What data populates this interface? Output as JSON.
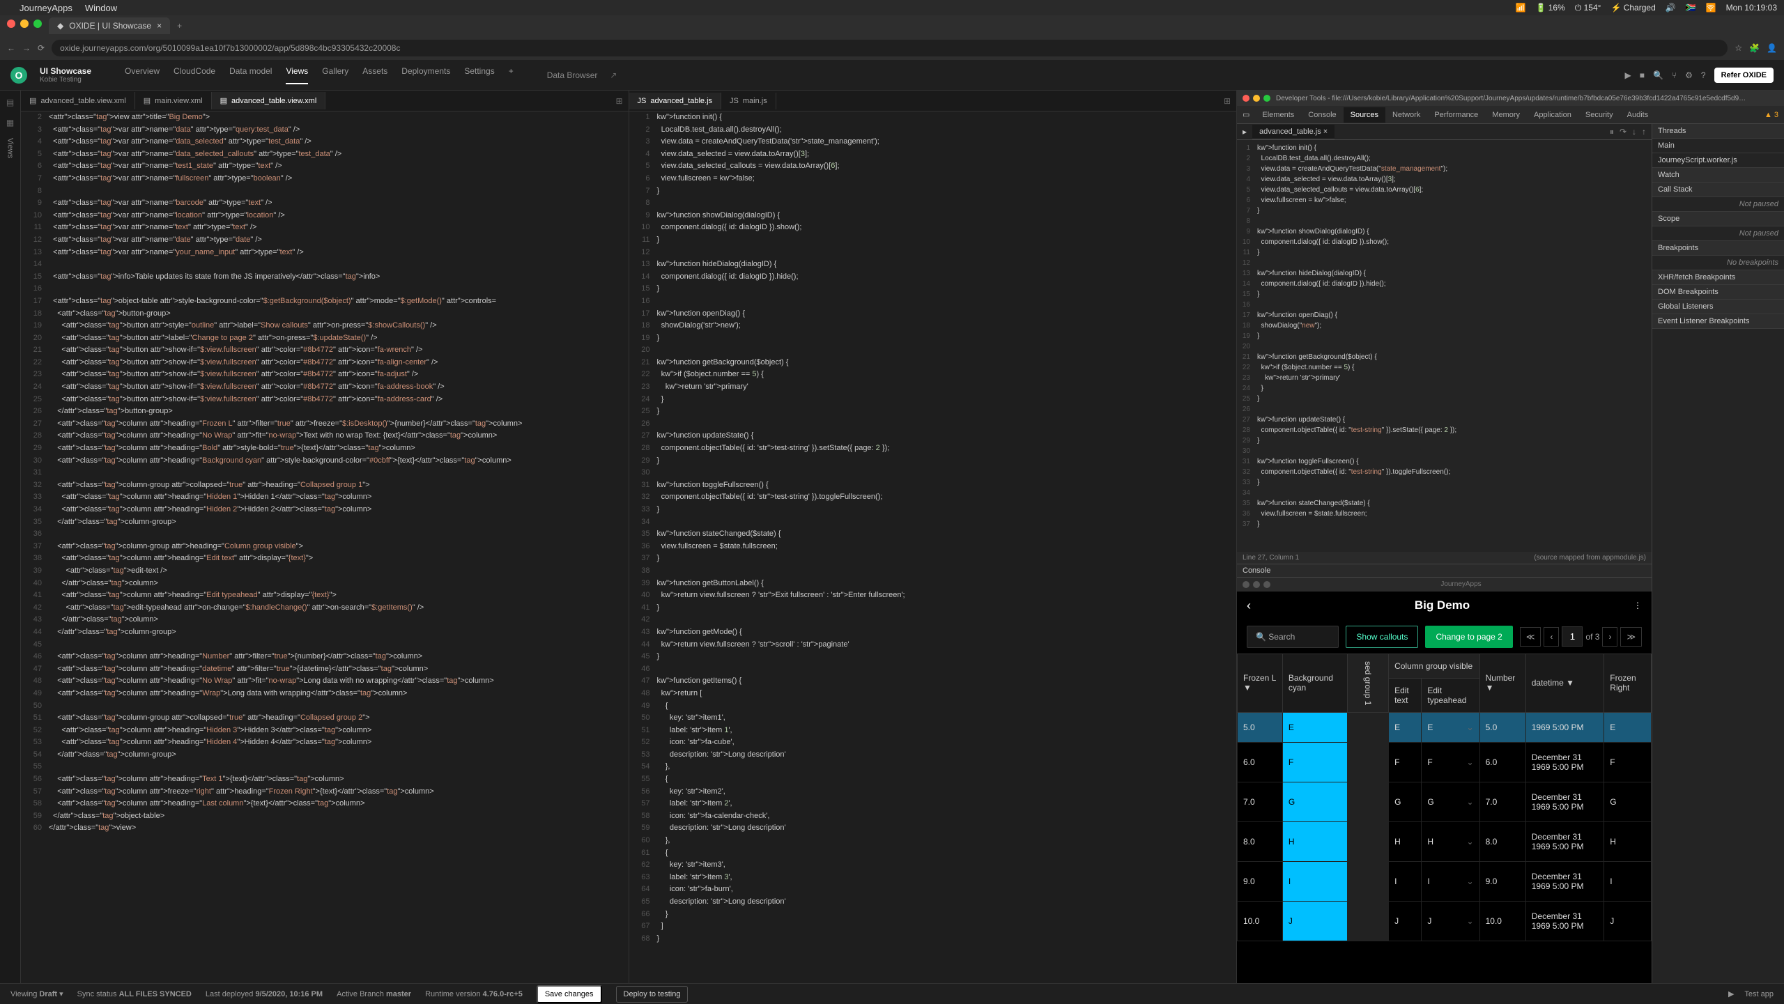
{
  "menubar": {
    "app": "JourneyApps",
    "menu1": "Window",
    "right": [
      "📶",
      "🔋 16%",
      "⏻ 154°",
      "⚡ Charged",
      "🔊",
      "🇿🇦",
      "🛜",
      "Mon 10:19:03"
    ]
  },
  "browser": {
    "tab_title": "OXIDE | UI Showcase",
    "url": "oxide.journeyapps.com/org/5010099a1ea10f7b13000002/app/5d898c4bc93305432c20008c"
  },
  "ide": {
    "title": "UI Showcase",
    "subtitle": "Kobie Testing",
    "tabs": [
      "Overview",
      "CloudCode",
      "Data model",
      "Views",
      "Gallery",
      "Assets",
      "Deployments",
      "Settings"
    ],
    "active_tab": "Views",
    "data_browser": "Data Browser",
    "refer": "Refer OXIDE"
  },
  "left_pane": {
    "tabs": [
      "advanced_table.view.xml",
      "main.view.xml",
      "advanced_table.view.xml"
    ],
    "active": 2,
    "code": [
      "<view title=\"Big Demo\">",
      "  <var name=\"data\" type=\"query:test_data\" />",
      "  <var name=\"data_selected\" type=\"test_data\" />",
      "  <var name=\"data_selected_callouts\" type=\"test_data\" />",
      "  <var name=\"test1_state\" type=\"text\" />",
      "  <var name=\"fullscreen\" type=\"boolean\" />",
      "",
      "  <var name=\"barcode\" type=\"text\" />",
      "  <var name=\"location\" type=\"location\" />",
      "  <var name=\"text\" type=\"text\" />",
      "  <var name=\"date\" type=\"date\" />",
      "  <var name=\"your_name_input\" type=\"text\" />",
      "",
      "  <info>Table updates its state from the JS imperatively</info>",
      "",
      "  <object-table style-background-color=\"$:getBackground($object)\" mode=\"$:getMode()\" controls=",
      "    <button-group>",
      "      <button style=\"outline\" label=\"Show callouts\" on-press=\"$:showCallouts()\" />",
      "      <button label=\"Change to page 2\" on-press=\"$:updateState()\" />",
      "      <button show-if=\"$:view.fullscreen\" color=\"#8b4772\" icon=\"fa-wrench\" />",
      "      <button show-if=\"$:view.fullscreen\" color=\"#8b4772\" icon=\"fa-align-center\" />",
      "      <button show-if=\"$:view.fullscreen\" color=\"#8b4772\" icon=\"fa-adjust\" />",
      "      <button show-if=\"$:view.fullscreen\" color=\"#8b4772\" icon=\"fa-address-book\" />",
      "      <button show-if=\"$:view.fullscreen\" color=\"#8b4772\" icon=\"fa-address-card\" />",
      "    </button-group>",
      "    <column heading=\"Frozen L\" filter=\"true\" freeze=\"$:isDesktop()\">{number}</column>",
      "    <column heading=\"No Wrap\" fit=\"no-wrap\">Text with no wrap Text: {text}</column>",
      "    <column heading=\"Bold\" style-bold=\"true\">{text}</column>",
      "    <column heading=\"Background cyan\" style-background-color=\"#0cbff\">{text}</column>",
      "",
      "    <column-group collapsed=\"true\" heading=\"Collapsed group 1\">",
      "      <column heading=\"Hidden 1\">Hidden 1</column>",
      "      <column heading=\"Hidden 2\">Hidden 2</column>",
      "    </column-group>",
      "",
      "    <column-group heading=\"Column group visible\">",
      "      <column heading=\"Edit text\" display=\"{text}\">",
      "        <edit-text />",
      "      </column>",
      "      <column heading=\"Edit typeahead\" display=\"{text}\">",
      "        <edit-typeahead on-change=\"$:handleChange()\" on-search=\"$:getItems()\" />",
      "      </column>",
      "    </column-group>",
      "",
      "    <column heading=\"Number\" filter=\"true\">{number}</column>",
      "    <column heading=\"datetime\" filter=\"true\">{datetime}</column>",
      "    <column heading=\"No Wrap\" fit=\"no-wrap\">Long data with no wrapping</column>",
      "    <column heading=\"Wrap\">Long data with wrapping</column>",
      "",
      "    <column-group collapsed=\"true\" heading=\"Collapsed group 2\">",
      "      <column heading=\"Hidden 3\">Hidden 3</column>",
      "      <column heading=\"Hidden 4\">Hidden 4</column>",
      "    </column-group>",
      "",
      "    <column heading=\"Text 1\">{text}</column>",
      "    <column freeze=\"right\" heading=\"Frozen Right\">{text}</column>",
      "    <column heading=\"Last column\">{text}</column>",
      "  </object-table>",
      "</view>"
    ]
  },
  "right_pane": {
    "tabs": [
      "advanced_table.js",
      "main.js"
    ],
    "active": 0,
    "code": [
      "function init() {",
      "  LocalDB.test_data.all().destroyAll();",
      "  view.data = createAndQueryTestData('state_management');",
      "  view.data_selected = view.data.toArray()[3];",
      "  view.data_selected_callouts = view.data.toArray()[6];",
      "  view.fullscreen = false;",
      "}",
      "",
      "function showDialog(dialogID) {",
      "  component.dialog({ id: dialogID }).show();",
      "}",
      "",
      "function hideDialog(dialogID) {",
      "  component.dialog({ id: dialogID }).hide();",
      "}",
      "",
      "function openDiag() {",
      "  showDialog('new');",
      "}",
      "",
      "function getBackground($object) {",
      "  if ($object.number == 5) {",
      "    return 'primary'",
      "  }",
      "}",
      "",
      "function updateState() {",
      "  component.objectTable({ id: 'test-string' }).setState({ page: 2 });",
      "}",
      "",
      "function toggleFullscreen() {",
      "  component.objectTable({ id: 'test-string' }).toggleFullscreen();",
      "}",
      "",
      "function stateChanged($state) {",
      "  view.fullscreen = $state.fullscreen;",
      "}",
      "",
      "function getButtonLabel() {",
      "  return view.fullscreen ? 'Exit fullscreen' : 'Enter fullscreen';",
      "}",
      "",
      "function getMode() {",
      "  return view.fullscreen ? 'scroll' : 'paginate'",
      "}",
      "",
      "function getItems() {",
      "  return [",
      "    {",
      "      key: 'item1',",
      "      label: 'Item 1',",
      "      icon: 'fa-cube',",
      "      description: 'Long description'",
      "    },",
      "    {",
      "      key: 'item2',",
      "      label: 'Item 2',",
      "      icon: 'fa-calendar-check',",
      "      description: 'Long description'",
      "    },",
      "    {",
      "      key: 'item3',",
      "      label: 'Item 3',",
      "      icon: 'fa-burn',",
      "      description: 'Long description'",
      "    }",
      "  ]",
      "}"
    ]
  },
  "devtools": {
    "title": "Developer Tools - file:///Users/kobie/Library/Application%20Support/JourneyApps/updates/runtime/b7bfbdca05e76e39b3fcd1422a4765c91e5edcdf5d9…",
    "tabs": [
      "Elements",
      "Console",
      "Sources",
      "Network",
      "Performance",
      "Memory",
      "Application",
      "Security",
      "Audits"
    ],
    "active": "Sources",
    "warnings": "▲ 3",
    "file": "advanced_table.js",
    "code": [
      "function init() {",
      "  LocalDB.test_data.all().destroyAll();",
      "  view.data = createAndQueryTestData(\"state_management\");",
      "  view.data_selected = view.data.toArray()[3];",
      "  view.data_selected_callouts = view.data.toArray()[6];",
      "  view.fullscreen = false;",
      "}",
      "",
      "function showDialog(dialogID) {",
      "  component.dialog({ id: dialogID }).show();",
      "}",
      "",
      "function hideDialog(dialogID) {",
      "  component.dialog({ id: dialogID }).hide();",
      "}",
      "",
      "function openDiag() {",
      "  showDialog(\"new\");",
      "}",
      "",
      "function getBackground($object) {",
      "  if ($object.number == 5) {",
      "    return 'primary'",
      "  }",
      "}",
      "",
      "function updateState() {",
      "  component.objectTable({ id: \"test-string\" }).setState({ page: 2 });",
      "}",
      "",
      "function toggleFullscreen() {",
      "  component.objectTable({ id: \"test-string\" }).toggleFullscreen();",
      "}",
      "",
      "function stateChanged($state) {",
      "  view.fullscreen = $state.fullscreen;",
      "}"
    ],
    "status_left": "Line 27, Column 1",
    "status_right": "(source mapped from appmodule.js)",
    "console_label": "Console",
    "sidebar": {
      "threads": "Threads",
      "main": "Main",
      "worker": "JourneyScript.worker.js",
      "watch": "Watch",
      "callstack": "Call Stack",
      "notpaused": "Not paused",
      "scope": "Scope",
      "breakpoints": "Breakpoints",
      "nobreak": "No breakpoints",
      "xhr": "XHR/fetch Breakpoints",
      "dom": "DOM Breakpoints",
      "global": "Global Listeners",
      "event": "Event Listener Breakpoints"
    }
  },
  "preview": {
    "journeyapps_label": "JourneyApps",
    "title": "Big Demo",
    "search_placeholder": "Search",
    "btn1": "Show callouts",
    "btn2": "Change to page 2",
    "page_current": "1",
    "page_total": "of 3",
    "group_visible": "Column group visible",
    "collapsed_label": "sed group 1",
    "headers": [
      "Frozen L",
      "Background cyan",
      "Edit text",
      "Edit typeahead",
      "Number",
      "datetime",
      "Frozen Right"
    ],
    "rows": [
      {
        "fl": "5.0",
        "bg": "E",
        "et": "E",
        "ta": "E",
        "num": "5.0",
        "dt": "1969 5:00 PM",
        "fr": "E",
        "hl": true
      },
      {
        "fl": "6.0",
        "bg": "F",
        "et": "F",
        "ta": "F",
        "num": "6.0",
        "dt": "December 31 1969 5:00 PM",
        "fr": "F"
      },
      {
        "fl": "7.0",
        "bg": "G",
        "et": "G",
        "ta": "G",
        "num": "7.0",
        "dt": "December 31 1969 5:00 PM",
        "fr": "G"
      },
      {
        "fl": "8.0",
        "bg": "H",
        "et": "H",
        "ta": "H",
        "num": "8.0",
        "dt": "December 31 1969 5:00 PM",
        "fr": "H"
      },
      {
        "fl": "9.0",
        "bg": "I",
        "et": "I",
        "ta": "I",
        "num": "9.0",
        "dt": "December 31 1969 5:00 PM",
        "fr": "I"
      },
      {
        "fl": "10.0",
        "bg": "J",
        "et": "J",
        "ta": "J",
        "num": "10.0",
        "dt": "December 31 1969 5:00 PM",
        "fr": "J"
      }
    ]
  },
  "statusbar": {
    "viewing": "Viewing",
    "draft": "Draft",
    "sync": "Sync status",
    "synced": "ALL FILES SYNCED",
    "deployed": "Last deployed",
    "deployed_val": "9/5/2020, 10:16 PM",
    "branch": "Active Branch",
    "branch_val": "master",
    "runtime": "Runtime version",
    "runtime_val": "4.76.0-rc+5",
    "save": "Save changes",
    "deploy": "Deploy to testing",
    "test": "Test app"
  }
}
